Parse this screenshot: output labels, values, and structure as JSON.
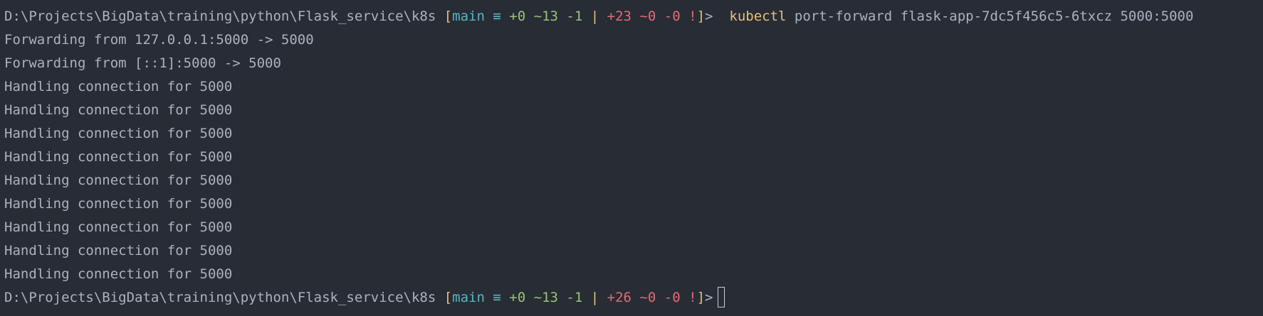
{
  "terminal": {
    "prompt1": {
      "path": "D:\\Projects\\BigData\\training\\python\\Flask_service\\k8s",
      "bracket_open": "[",
      "branch": "main",
      "sync": "≡",
      "staged_add": "+0",
      "staged_mod": "~13",
      "staged_del": "-1",
      "separator": "|",
      "unstaged_add": "+23",
      "unstaged_mod": "~0",
      "unstaged_del": "-0",
      "unstaged_flag": "!",
      "bracket_close": "]",
      "prompt_char": ">",
      "command": "kubectl",
      "args": "port-forward flask-app-7dc5f456c5-6txcz 5000:5000"
    },
    "output": [
      "Forwarding from 127.0.0.1:5000 -> 5000",
      "Forwarding from [::1]:5000 -> 5000",
      "Handling connection for 5000",
      "Handling connection for 5000",
      "Handling connection for 5000",
      "Handling connection for 5000",
      "Handling connection for 5000",
      "Handling connection for 5000",
      "Handling connection for 5000",
      "Handling connection for 5000",
      "Handling connection for 5000"
    ],
    "prompt2": {
      "path": "D:\\Projects\\BigData\\training\\python\\Flask_service\\k8s",
      "bracket_open": "[",
      "branch": "main",
      "sync": "≡",
      "staged_add": "+0",
      "staged_mod": "~13",
      "staged_del": "-1",
      "separator": "|",
      "unstaged_add": "+26",
      "unstaged_mod": "~0",
      "unstaged_del": "-0",
      "unstaged_flag": "!",
      "bracket_close": "]",
      "prompt_char": ">"
    },
    "colors": {
      "background": "#282c34",
      "text": "#abb2bf",
      "branch": "#56b6c2",
      "added": "#98c379",
      "unstaged": "#e06c75",
      "command": "#e5c07b"
    }
  }
}
